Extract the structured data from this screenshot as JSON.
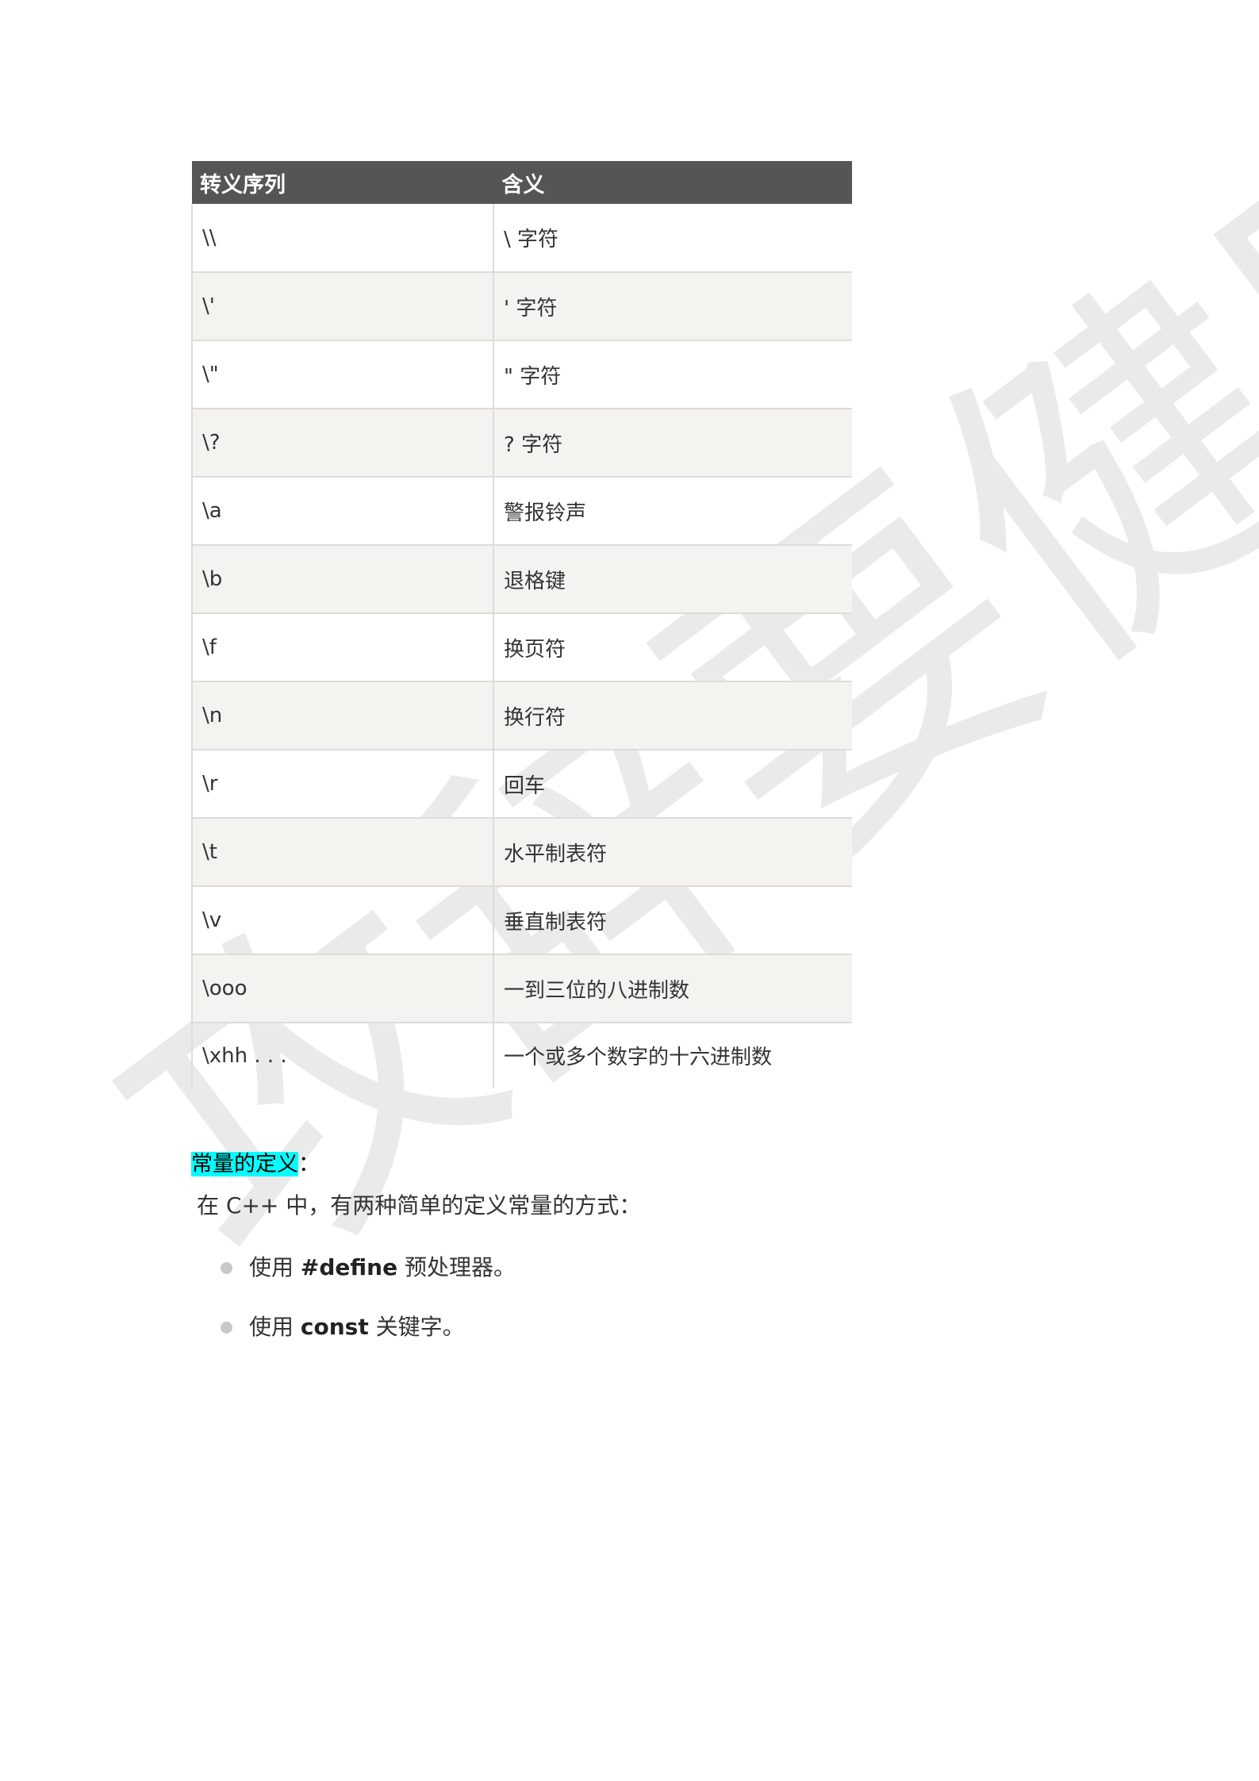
{
  "watermark": "攻辞要健康",
  "table": {
    "headers": [
      "转义序列",
      "含义"
    ],
    "rows": [
      [
        "\\\\",
        "\\ 字符"
      ],
      [
        "\\'",
        "' 字符"
      ],
      [
        "\\\"",
        "\" 字符"
      ],
      [
        "\\?",
        "? 字符"
      ],
      [
        "\\a",
        "警报铃声"
      ],
      [
        "\\b",
        "退格键"
      ],
      [
        "\\f",
        "换页符"
      ],
      [
        "\\n",
        "换行符"
      ],
      [
        "\\r",
        "回车"
      ],
      [
        "\\t",
        "水平制表符"
      ],
      [
        "\\v",
        "垂直制表符"
      ],
      [
        "\\ooo",
        "一到三位的八进制数"
      ],
      [
        "\\xhh . . .",
        "一个或多个数字的十六进制数"
      ]
    ]
  },
  "section": {
    "heading": "常量的定义",
    "heading_suffix": "：",
    "intro": "在 C++ 中，有两种简单的定义常量的方式：",
    "bullets": [
      {
        "prefix": "使用 ",
        "keyword": "#define",
        "suffix": " 预处理器。"
      },
      {
        "prefix": "使用 ",
        "keyword": "const",
        "suffix": " 关键字。"
      }
    ]
  },
  "colors": {
    "header_bg": "#555555",
    "stripe_bg": "#f4f3f0",
    "highlight": "#00ffff",
    "bullet_dot": "#c8c8c8"
  }
}
